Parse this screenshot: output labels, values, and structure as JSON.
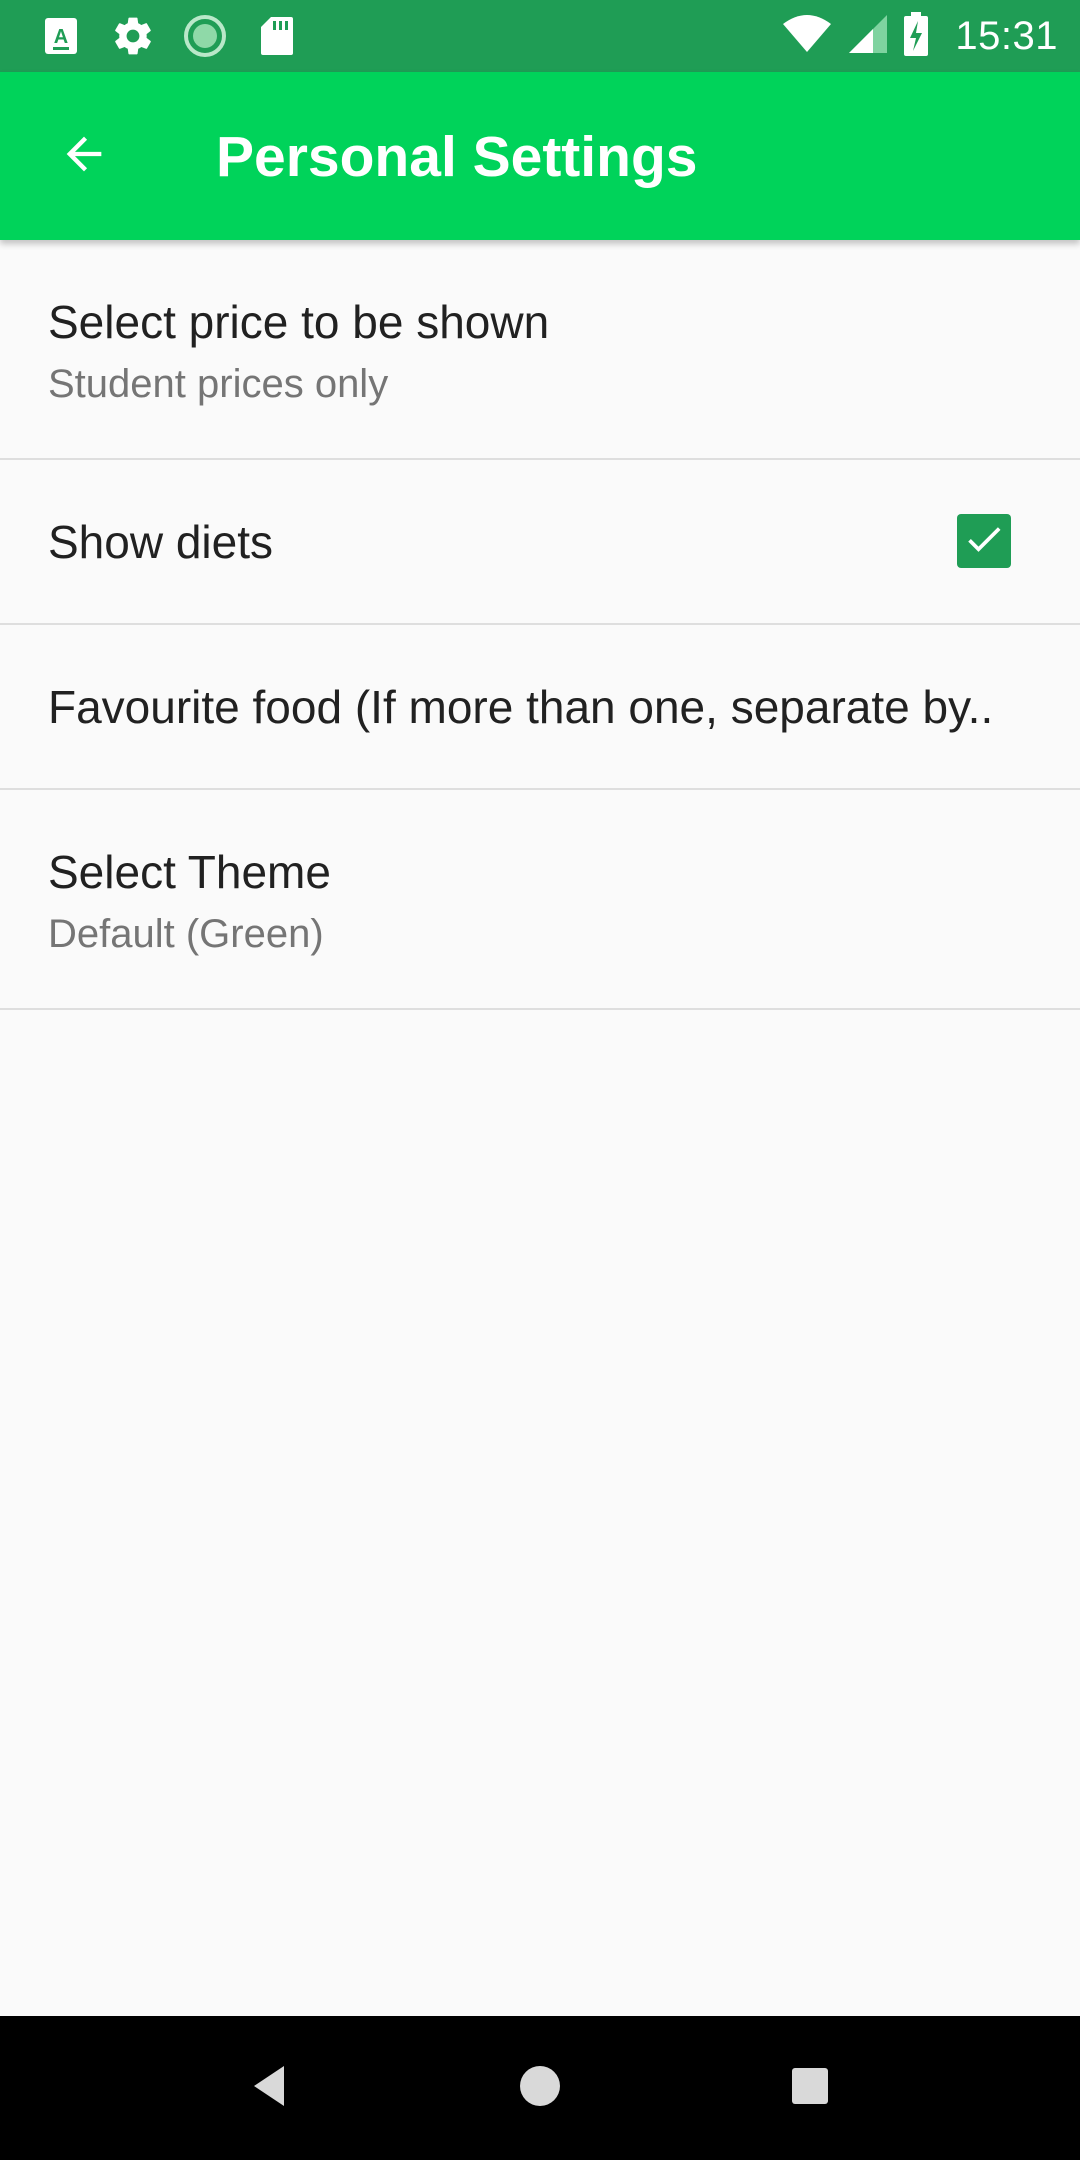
{
  "status_bar": {
    "time": "15:31",
    "left_icons": [
      "a11y-app-icon",
      "settings-gear-icon",
      "sync-progress-icon",
      "sd-card-icon"
    ],
    "right_icons": [
      "wifi-icon",
      "cell-signal-icon",
      "battery-charging-icon"
    ]
  },
  "app_bar": {
    "title": "Personal Settings",
    "back_icon": "arrow-back-icon",
    "background": "#00d35a"
  },
  "colors": {
    "status_bar": "#1f9d55",
    "accent": "#1f9d55",
    "nav_bar": "#000000",
    "primary_text": "#212121",
    "secondary_text": "#757575",
    "background": "#fafafa"
  },
  "preferences": [
    {
      "title": "Select price to be shown",
      "summary": "Student prices only"
    },
    {
      "title": "Show diets",
      "checkbox_checked": true
    },
    {
      "title": "Favourite food (If more than one, separate by.."
    },
    {
      "title": "Select Theme",
      "summary": "Default (Green)"
    }
  ],
  "nav_bar": {
    "buttons": [
      "back-triangle-icon",
      "home-circle-icon",
      "recents-square-icon"
    ]
  }
}
